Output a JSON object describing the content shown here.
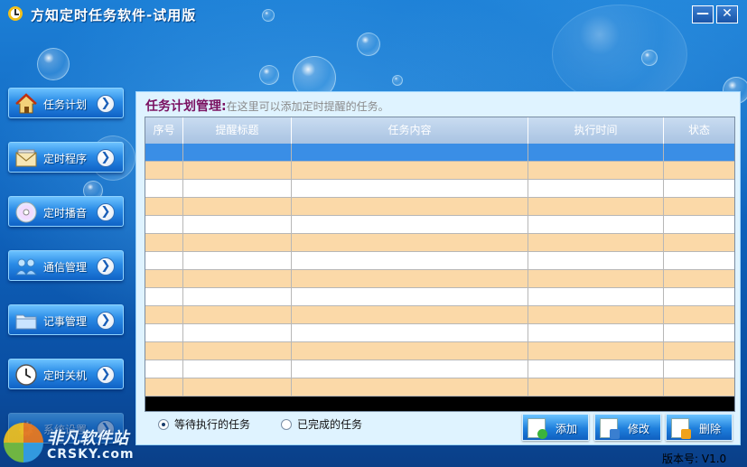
{
  "window": {
    "title": "方知定时任务软件-试用版",
    "minimize_label": "—",
    "close_label": "✕"
  },
  "sidebar": {
    "items": [
      {
        "label": "任务计划",
        "icon": "house-icon"
      },
      {
        "label": "定时程序",
        "icon": "envelope-icon"
      },
      {
        "label": "定时播音",
        "icon": "cd-icon"
      },
      {
        "label": "通信管理",
        "icon": "contacts-icon"
      },
      {
        "label": "记事管理",
        "icon": "folder-icon"
      },
      {
        "label": "定时关机",
        "icon": "clock-icon"
      },
      {
        "label": "系统设置",
        "icon": "gear-icon"
      }
    ],
    "arrow_glyph": "❯"
  },
  "main": {
    "title": "任务计划管理:",
    "subtitle": "在这里可以添加定时提醒的任务。",
    "table": {
      "columns": [
        "序号",
        "提醒标题",
        "任务内容",
        "执行时间",
        "状态"
      ],
      "row_count": 14
    },
    "filters": {
      "pending": "等待执行的任务",
      "completed": "已完成的任务",
      "selected": "pending"
    },
    "buttons": {
      "add": "添加",
      "edit": "修改",
      "delete": "删除"
    }
  },
  "footer": {
    "version": "版本号: V1.0"
  },
  "watermark": {
    "line1": "非凡软件站",
    "line2": "CRSKY.com"
  },
  "colors": {
    "selected_row": "#3a8ee6",
    "alt_row": "#fbd9a8",
    "title_accent": "#7a1060"
  }
}
